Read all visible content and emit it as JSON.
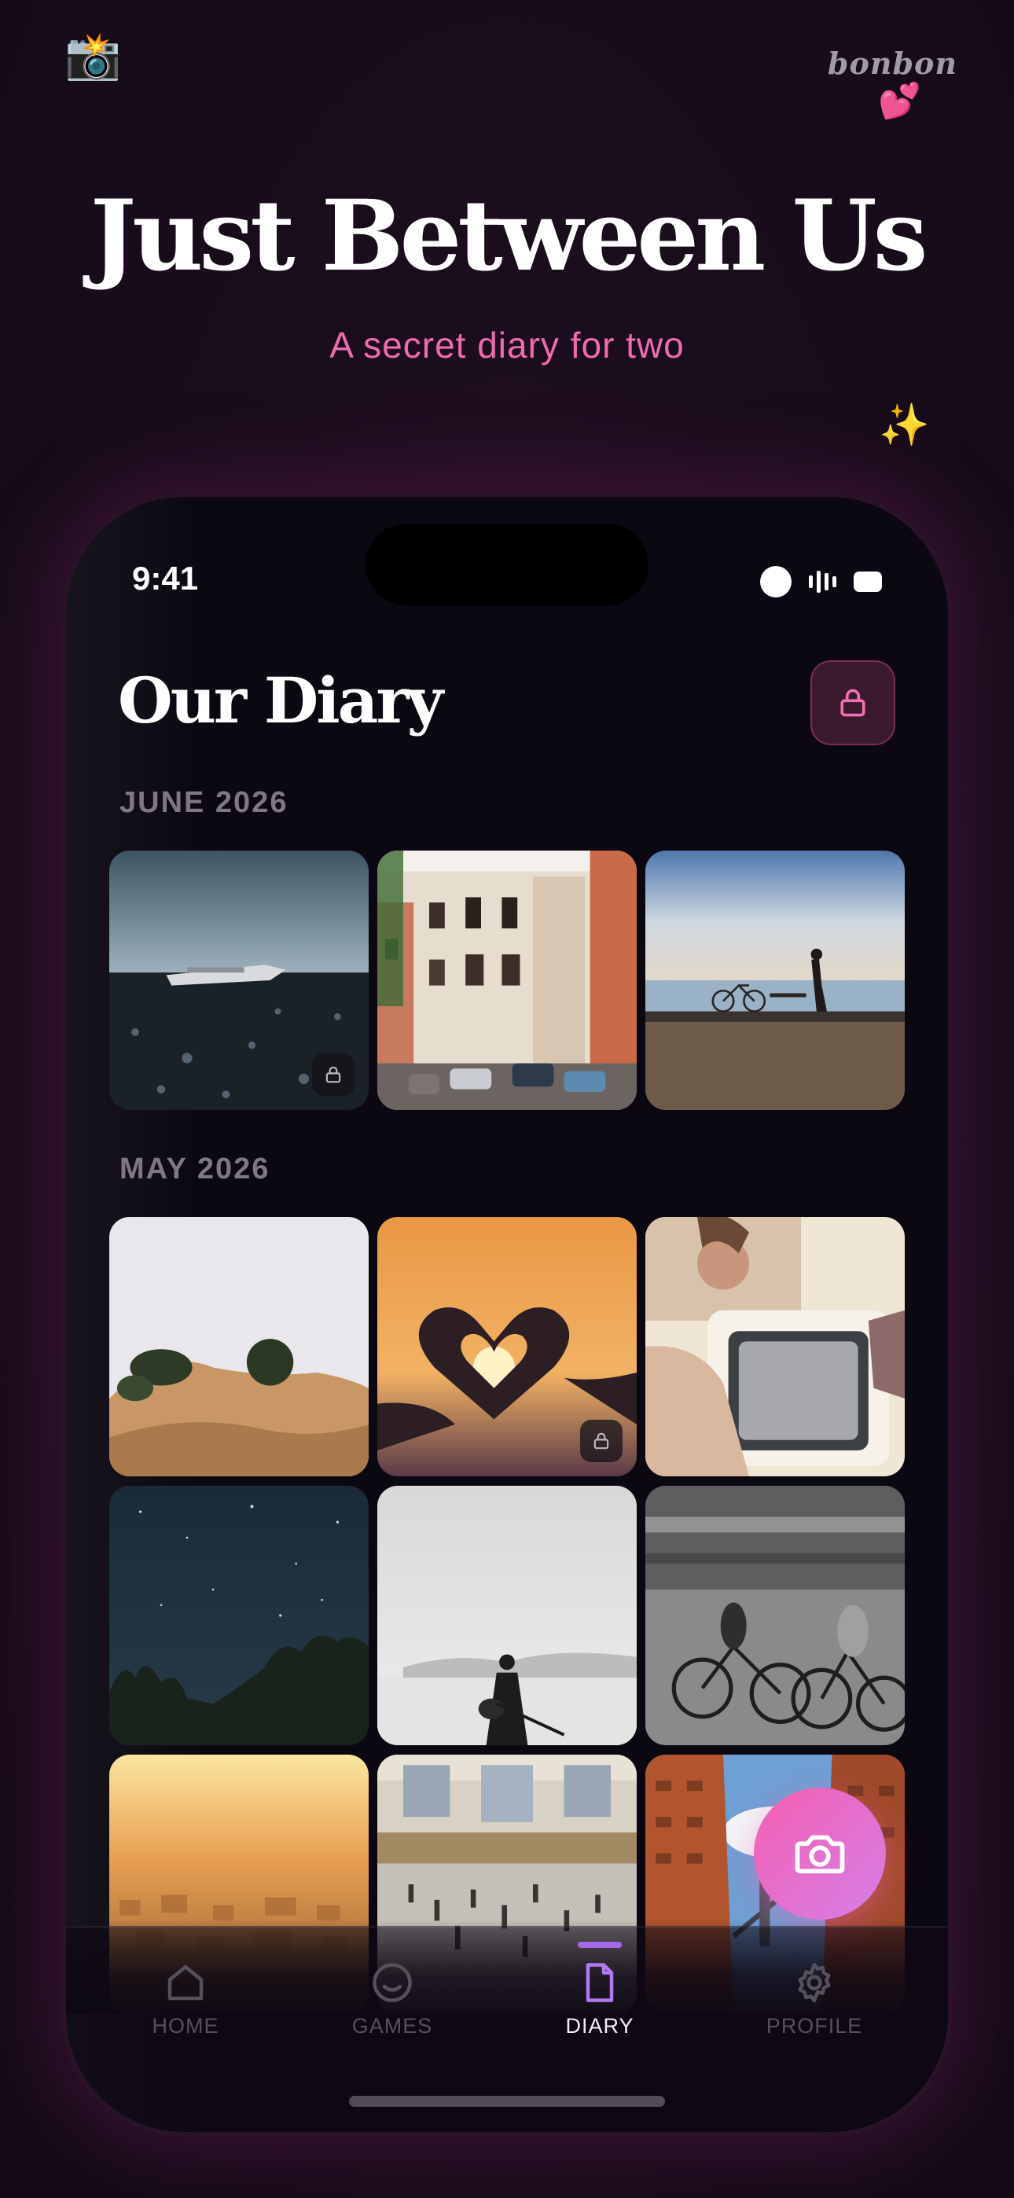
{
  "header": {
    "camera_emoji": "📸",
    "brand": "bonbon",
    "hearts_emoji": "💕",
    "title": "Just Between Us",
    "subtitle": "A secret diary for two",
    "sparkle_emoji": "✨"
  },
  "status_bar": {
    "time": "9:41"
  },
  "diary": {
    "title": "Our Diary",
    "lock_icon": "lock-icon",
    "sections": [
      {
        "label": "JUNE 2026",
        "photos": [
          "plane wreck on black beach (locked)",
          "old town street",
          "person with bicycle by sea"
        ]
      },
      {
        "label": "MAY 2026",
        "photos": [
          "misty hill with trees",
          "heart hands at sunset (locked)",
          "couple through van window",
          "starry night over trees",
          "silhouette with guitar in desert",
          "blurred cyclists",
          "golden city haze",
          "grand station hall",
          "brick street with bridge"
        ]
      }
    ]
  },
  "fab": {
    "icon": "camera-icon"
  },
  "tabbar": {
    "items": [
      {
        "label": "HOME",
        "icon": "home-icon"
      },
      {
        "label": "GAMES",
        "icon": "smile-icon"
      },
      {
        "label": "DIARY",
        "icon": "document-icon",
        "active": true
      },
      {
        "label": "PROFILE",
        "icon": "gear-icon"
      }
    ]
  },
  "colors": {
    "accent_pink": "#ef6bb0",
    "accent_purple": "#a568e8",
    "background": "#1a0d1c"
  }
}
